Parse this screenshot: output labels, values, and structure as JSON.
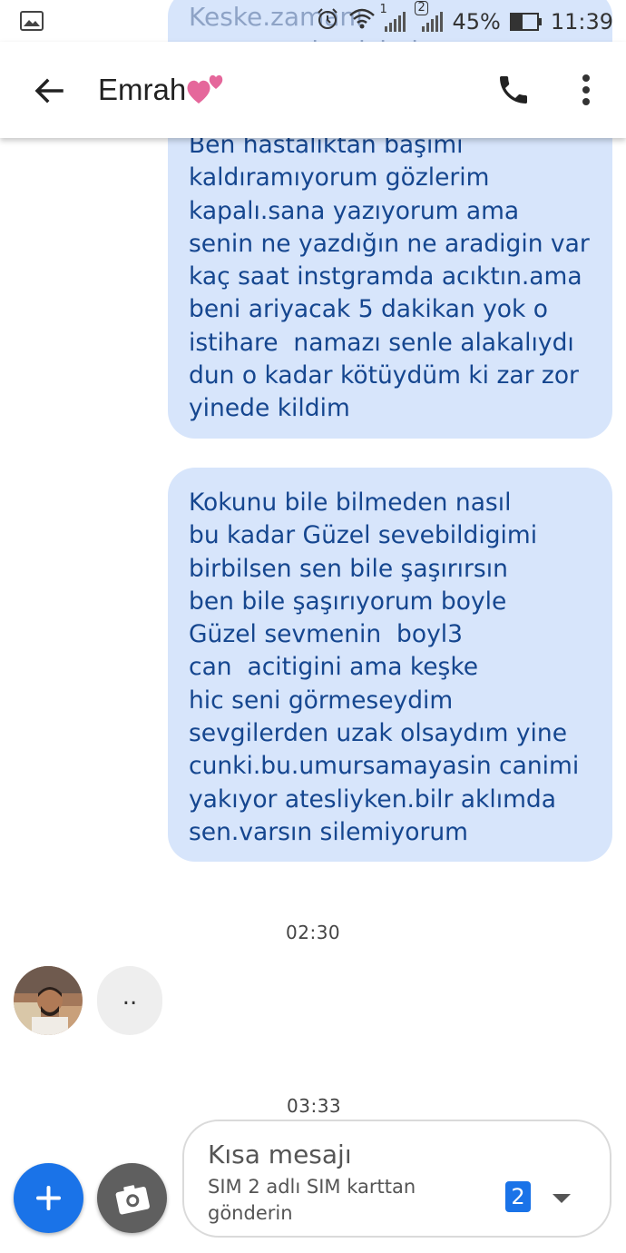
{
  "status_bar": {
    "battery_percent": "45%",
    "battery_level": 0.45,
    "time": "11:39",
    "sim1_label": "1",
    "sim2_label": "2"
  },
  "toolbar": {
    "contact_name": "Emrah"
  },
  "messages": {
    "peek_text": "Keske.zamanı\naçmasaydım.içimi sana",
    "bubble1": "Ben hastalıktan başımı\nkaldıramıyorum gözlerim\nkapalı.sana yazıyorum ama\nsenin ne yazdığın ne aradigin var\nkaç saat instgramda acıktın.ama\nbeni ariyacak 5 dakikan yok o\nistihare  namazı senle alakalıydı\ndun o kadar kötüydüm ki zar zor\nyinede kildim",
    "bubble2": "Kokunu bile bilmeden nasıl\nbu kadar Güzel sevebildigimi\nbirbilsen sen bile şaşırırsın\nben bile şaşırıyorum boyle\nGüzel sevmenin  boyl3\ncan  acitigini ama keşke\nhic seni görmeseydim\nsevgilerden uzak olsaydım yine\ncunki.bu.umursamayasin canimi\nyakıyor atesliyken.bilr aklımda\nsen.varsın silemiyorum",
    "timestamp1": "02:30",
    "incoming_text": "..",
    "timestamp2": "03:33"
  },
  "compose": {
    "placeholder": "Kısa mesajı",
    "sim_hint": "SIM 2 adlı SIM karttan\ngönderin",
    "sim_badge": "2"
  },
  "colors": {
    "bubble": "#d7e5fb",
    "bubble_text": "#15468f",
    "accent": "#1a73e8"
  }
}
